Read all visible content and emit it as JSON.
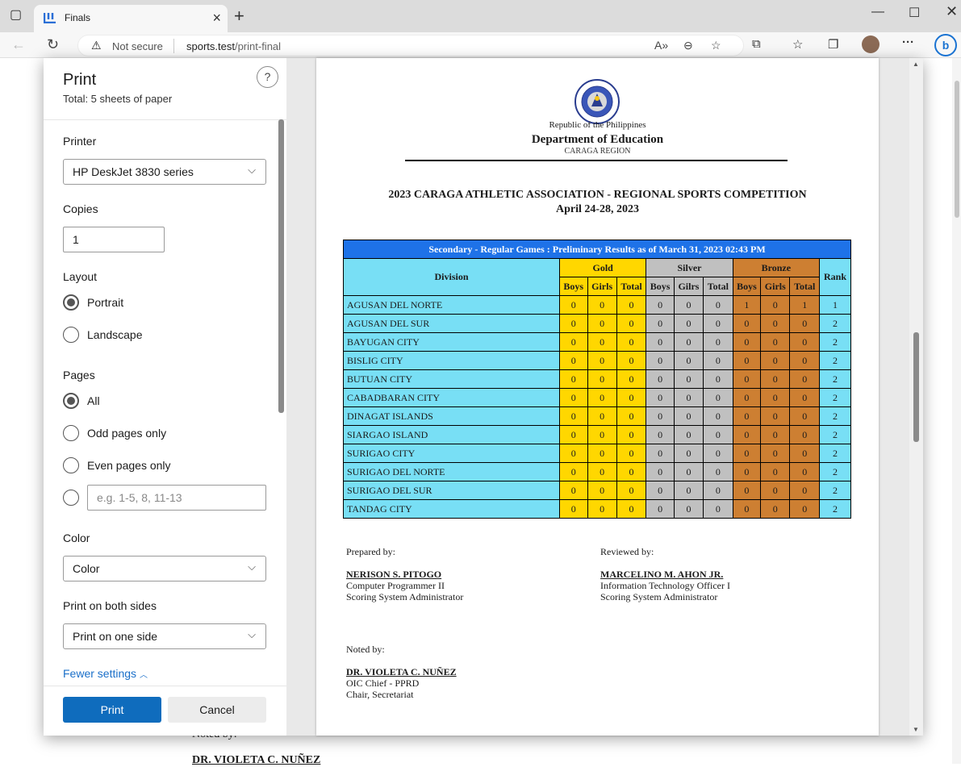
{
  "browser": {
    "tab_title": "Finals",
    "security_label": "Not secure",
    "url_host": "sports.test",
    "url_path": "/print-final"
  },
  "print_panel": {
    "title": "Print",
    "total": "Total: 5 sheets of paper",
    "help": "?",
    "printer_label": "Printer",
    "printer_value": "HP DeskJet 3830 series",
    "copies_label": "Copies",
    "copies_value": "1",
    "layout_label": "Layout",
    "layout_options": [
      "Portrait",
      "Landscape"
    ],
    "layout_selected": "Portrait",
    "pages_label": "Pages",
    "pages_options": [
      "All",
      "Odd pages only",
      "Even pages only"
    ],
    "pages_selected": "All",
    "pages_range_placeholder": "e.g. 1-5, 8, 11-13",
    "color_label": "Color",
    "color_value": "Color",
    "duplex_label": "Print on both sides",
    "duplex_value": "Print on one side",
    "fewer_settings": "Fewer settings",
    "print_button": "Print",
    "cancel_button": "Cancel"
  },
  "document": {
    "republic": "Republic of the Philippines",
    "department": "Department of Education",
    "region": "CARAGA REGION",
    "competition": "2023 CARAGA ATHLETIC ASSOCIATION - REGIONAL SPORTS COMPETITION",
    "dates": "April 24-28, 2023",
    "table_caption": "Secondary - Regular Games : Preliminary Results as of March 31, 2023 02:43 PM",
    "headers": {
      "division": "Division",
      "gold": "Gold",
      "silver": "Silver",
      "bronze": "Bronze",
      "rank": "Rank",
      "gold_sub": [
        "Boys",
        "Girls",
        "Total"
      ],
      "silver_sub": [
        "Boys",
        "Gilrs",
        "Total"
      ],
      "bronze_sub": [
        "Boys",
        "Girls",
        "Total"
      ]
    },
    "rows": [
      {
        "division": "AGUSAN DEL NORTE",
        "g": [
          "0",
          "0",
          "0"
        ],
        "s": [
          "0",
          "0",
          "0"
        ],
        "b": [
          "1",
          "0",
          "1"
        ],
        "rank": "1"
      },
      {
        "division": "AGUSAN DEL SUR",
        "g": [
          "0",
          "0",
          "0"
        ],
        "s": [
          "0",
          "0",
          "0"
        ],
        "b": [
          "0",
          "0",
          "0"
        ],
        "rank": "2"
      },
      {
        "division": "BAYUGAN CITY",
        "g": [
          "0",
          "0",
          "0"
        ],
        "s": [
          "0",
          "0",
          "0"
        ],
        "b": [
          "0",
          "0",
          "0"
        ],
        "rank": "2"
      },
      {
        "division": "BISLIG CITY",
        "g": [
          "0",
          "0",
          "0"
        ],
        "s": [
          "0",
          "0",
          "0"
        ],
        "b": [
          "0",
          "0",
          "0"
        ],
        "rank": "2"
      },
      {
        "division": "BUTUAN CITY",
        "g": [
          "0",
          "0",
          "0"
        ],
        "s": [
          "0",
          "0",
          "0"
        ],
        "b": [
          "0",
          "0",
          "0"
        ],
        "rank": "2"
      },
      {
        "division": "CABADBARAN CITY",
        "g": [
          "0",
          "0",
          "0"
        ],
        "s": [
          "0",
          "0",
          "0"
        ],
        "b": [
          "0",
          "0",
          "0"
        ],
        "rank": "2"
      },
      {
        "division": "DINAGAT ISLANDS",
        "g": [
          "0",
          "0",
          "0"
        ],
        "s": [
          "0",
          "0",
          "0"
        ],
        "b": [
          "0",
          "0",
          "0"
        ],
        "rank": "2"
      },
      {
        "division": "SIARGAO ISLAND",
        "g": [
          "0",
          "0",
          "0"
        ],
        "s": [
          "0",
          "0",
          "0"
        ],
        "b": [
          "0",
          "0",
          "0"
        ],
        "rank": "2"
      },
      {
        "division": "SURIGAO CITY",
        "g": [
          "0",
          "0",
          "0"
        ],
        "s": [
          "0",
          "0",
          "0"
        ],
        "b": [
          "0",
          "0",
          "0"
        ],
        "rank": "2"
      },
      {
        "division": "SURIGAO DEL NORTE",
        "g": [
          "0",
          "0",
          "0"
        ],
        "s": [
          "0",
          "0",
          "0"
        ],
        "b": [
          "0",
          "0",
          "0"
        ],
        "rank": "2"
      },
      {
        "division": "SURIGAO DEL SUR",
        "g": [
          "0",
          "0",
          "0"
        ],
        "s": [
          "0",
          "0",
          "0"
        ],
        "b": [
          "0",
          "0",
          "0"
        ],
        "rank": "2"
      },
      {
        "division": "TANDAG CITY",
        "g": [
          "0",
          "0",
          "0"
        ],
        "s": [
          "0",
          "0",
          "0"
        ],
        "b": [
          "0",
          "0",
          "0"
        ],
        "rank": "2"
      }
    ],
    "prepared": {
      "label": "Prepared by:",
      "name": "NERISON S. PITOGO",
      "title1": "Computer Programmer II",
      "title2": "Scoring System Administrator"
    },
    "reviewed": {
      "label": "Reviewed by:",
      "name": "MARCELINO M. AHON JR.",
      "title1": "Information Technology Officer I",
      "title2": "Scoring System Administrator"
    },
    "noted": {
      "label": "Noted by:",
      "name": "DR. VIOLETA C. NUÑEZ",
      "title1": "OIC Chief - PPRD",
      "title2": "Chair, Secretariat"
    }
  },
  "background_page": {
    "noted_label": "Noted by:",
    "noted_name": "DR. VIOLETA C. NUÑEZ"
  },
  "colors": {
    "caption": "#1e72e8",
    "division_cells": "#78dff5",
    "gold": "#ffd700",
    "silver": "#c0c0c0",
    "bronze": "#cd7f32",
    "print_button": "#0f6cbd"
  }
}
